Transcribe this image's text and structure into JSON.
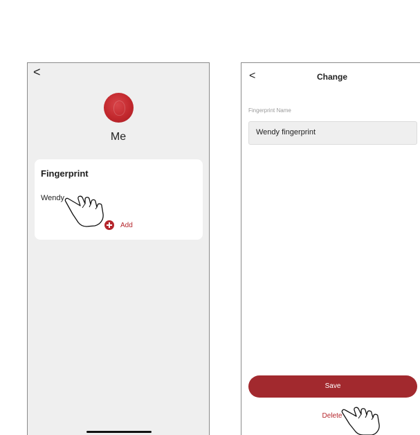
{
  "left_screen": {
    "back_glyph": "<",
    "profile_name": "Me",
    "fingerprint_card": {
      "title": "Fingerprint",
      "items": [
        "Wendy"
      ],
      "add_label": "Add"
    },
    "icons": [
      "back-chevron-icon",
      "avatar",
      "add-circle-icon",
      "hand-pointer-icon"
    ]
  },
  "right_screen": {
    "back_glyph": "<",
    "title": "Change",
    "field_label": "Fingerprint Name",
    "field_value": "Wendy fingerprint",
    "save_label": "Save",
    "delete_label": "Delete",
    "icons": [
      "back-chevron-icon",
      "hand-pointer-icon"
    ]
  },
  "colors": {
    "accent": "#b5262c",
    "save_button": "#a2292e",
    "screen_bg_left": "#efefef",
    "screen_bg_right": "#ffffff"
  }
}
